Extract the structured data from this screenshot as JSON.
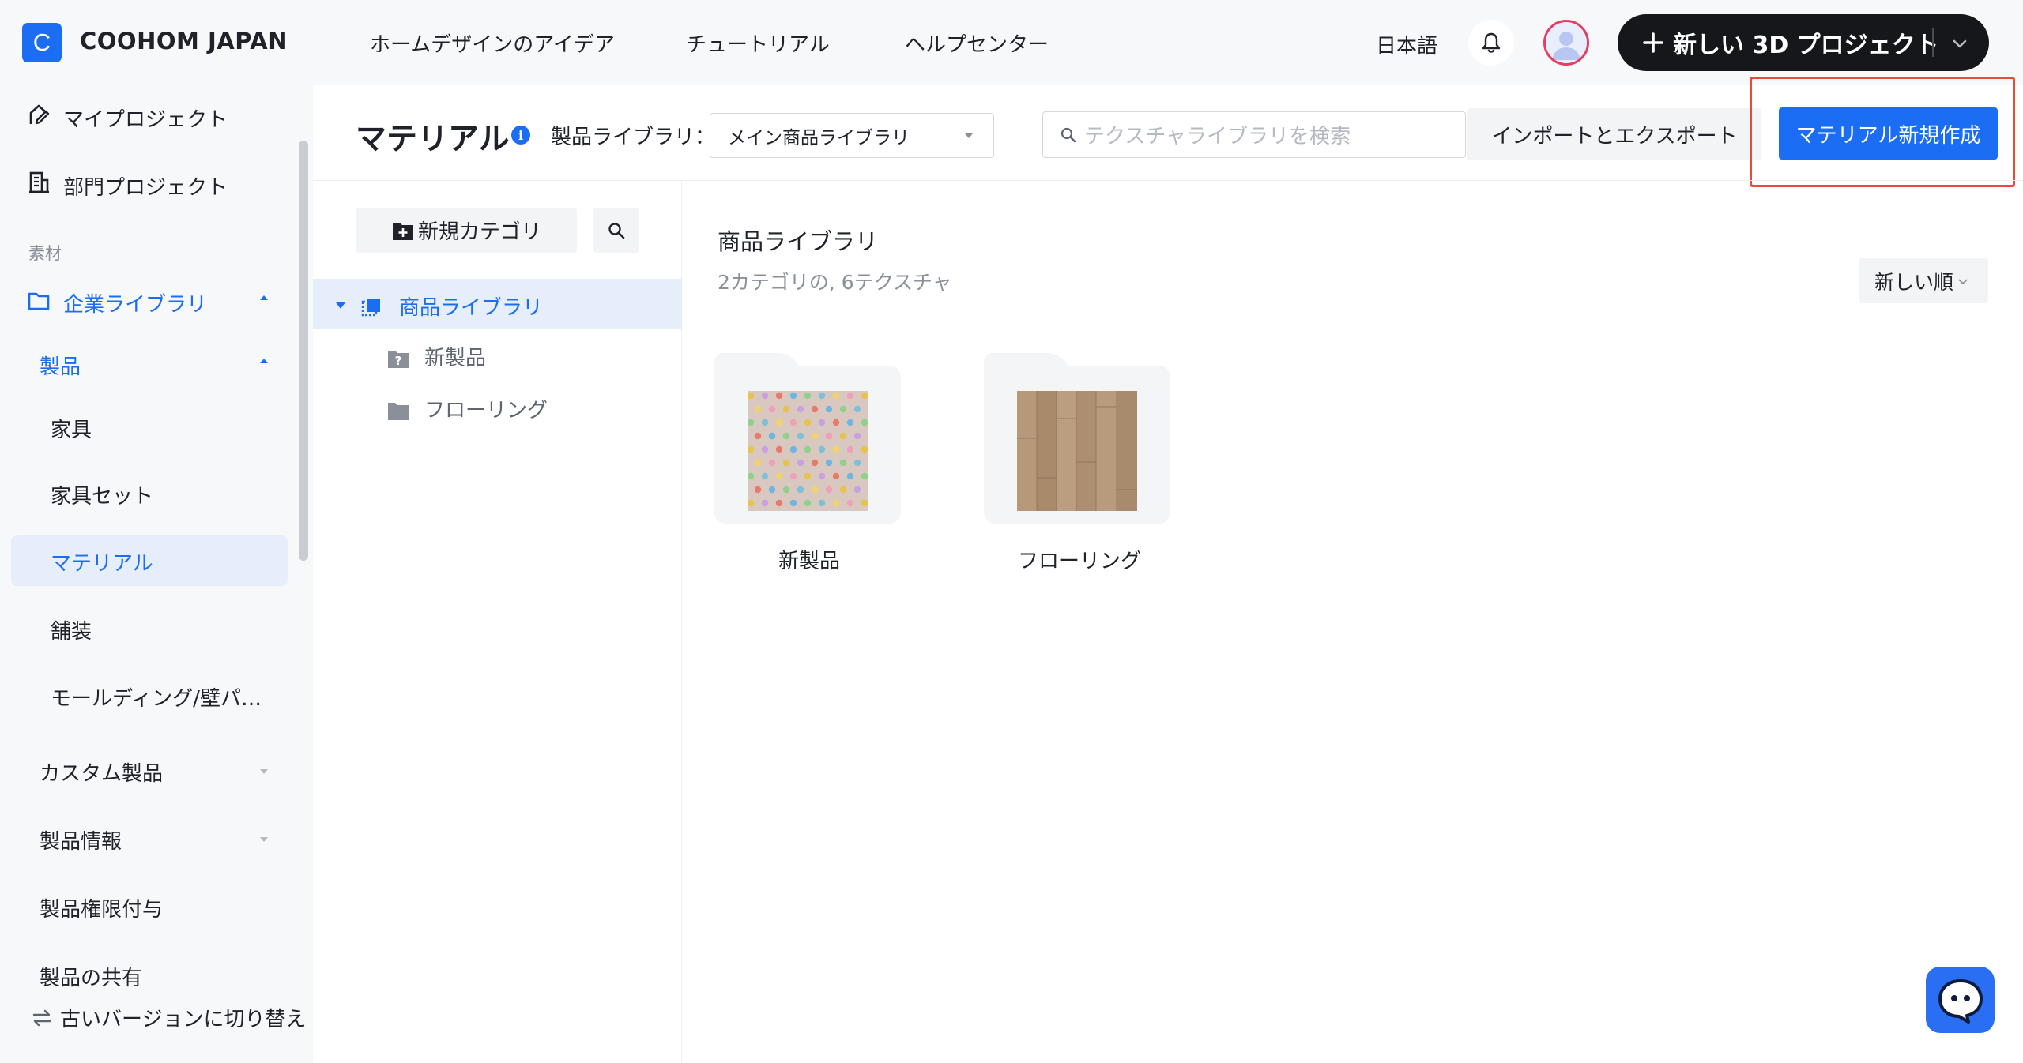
{
  "header": {
    "logo_letter": "C",
    "brand": "COOHOM JAPAN",
    "nav": [
      "ホームデザインのアイデア",
      "チュートリアル",
      "ヘルプセンター"
    ],
    "language": "日本語",
    "new_project_label": "新しい 3D プロジェクト"
  },
  "sidebar": {
    "my_projects": "マイプロジェクト",
    "dept_projects": "部門プロジェクト",
    "section_label": "素材",
    "enterprise_library": "企業ライブラリ",
    "products": "製品",
    "items": [
      "家具",
      "家具セット",
      "マテリアル",
      "舗装",
      "モールディング/壁パ…"
    ],
    "custom_products": "カスタム製品",
    "product_info": "製品情報",
    "product_permissions": "製品権限付与",
    "product_sharing": "製品の共有",
    "switch_version": "古いバージョンに切り替え"
  },
  "toolbar": {
    "title": "マテリアル",
    "info_glyph": "i",
    "library_label": "製品ライブラリ：",
    "library_selected": "メイン商品ライブラリ",
    "search_placeholder": "テクスチャライブラリを検索",
    "import_export": "インポートとエクスポート",
    "new_material": "マテリアル新規作成"
  },
  "tree": {
    "new_category": "新規カテゴリ",
    "root": "商品ライブラリ",
    "children": [
      "新製品",
      "フローリング"
    ]
  },
  "content": {
    "title": "商品ライブラリ",
    "subtitle": "2カテゴリの, 6テクスチャ",
    "sort_label": "新しい順",
    "folders": [
      {
        "name": "新製品",
        "thumbnail": "polka-dot-texture"
      },
      {
        "name": "フローリング",
        "thumbnail": "wood-floor-texture"
      }
    ]
  },
  "colors": {
    "accent": "#1b6ef3",
    "highlight": "#e64b3c",
    "dark_button": "#15171a"
  }
}
